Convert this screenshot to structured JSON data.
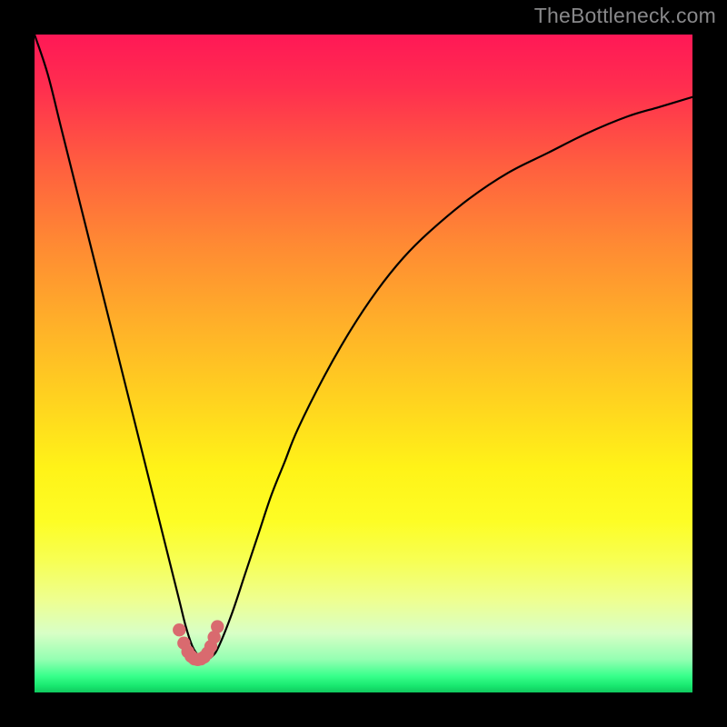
{
  "watermark": "TheBottleneck.com",
  "colors": {
    "background": "#000000",
    "curve": "#000000",
    "marker": "#d96a6f"
  },
  "chart_data": {
    "type": "line",
    "title": "",
    "xlabel": "",
    "ylabel": "",
    "xlim": [
      0,
      100
    ],
    "ylim": [
      0,
      100
    ],
    "grid": false,
    "legend": false,
    "series": [
      {
        "name": "bottleneck-curve",
        "x": [
          0,
          2,
          4,
          6,
          8,
          10,
          12,
          14,
          16,
          18,
          20,
          22,
          23,
          24,
          25,
          26,
          27,
          28,
          30,
          32,
          34,
          36,
          38,
          40,
          44,
          48,
          52,
          56,
          60,
          66,
          72,
          78,
          84,
          90,
          95,
          100
        ],
        "y": [
          100,
          94,
          86,
          78,
          70,
          62,
          54,
          46,
          38,
          30,
          22,
          14,
          10,
          7,
          5.5,
          5,
          5.5,
          7,
          12,
          18,
          24,
          30,
          35,
          40,
          48,
          55,
          61,
          66,
          70,
          75,
          79,
          82,
          85,
          87.5,
          89,
          90.5
        ]
      }
    ],
    "markers": {
      "name": "highlight-dots",
      "color": "#d96a6f",
      "x": [
        22.0,
        22.7,
        23.3,
        23.8,
        24.3,
        24.8,
        25.3,
        25.8,
        26.3,
        26.8,
        27.3,
        27.8
      ],
      "y": [
        9.5,
        7.5,
        6.2,
        5.5,
        5.1,
        5.0,
        5.1,
        5.4,
        6.0,
        7.0,
        8.4,
        10.0
      ]
    }
  }
}
